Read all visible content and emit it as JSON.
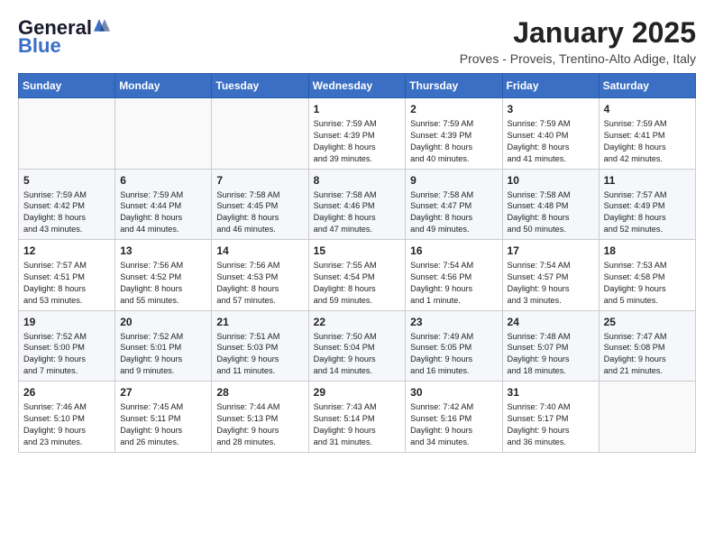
{
  "header": {
    "logo_general": "General",
    "logo_blue": "Blue",
    "month_title": "January 2025",
    "subtitle": "Proves - Proveis, Trentino-Alto Adige, Italy"
  },
  "weekdays": [
    "Sunday",
    "Monday",
    "Tuesday",
    "Wednesday",
    "Thursday",
    "Friday",
    "Saturday"
  ],
  "weeks": [
    [
      {
        "day": "",
        "content": ""
      },
      {
        "day": "",
        "content": ""
      },
      {
        "day": "",
        "content": ""
      },
      {
        "day": "1",
        "content": "Sunrise: 7:59 AM\nSunset: 4:39 PM\nDaylight: 8 hours\nand 39 minutes."
      },
      {
        "day": "2",
        "content": "Sunrise: 7:59 AM\nSunset: 4:39 PM\nDaylight: 8 hours\nand 40 minutes."
      },
      {
        "day": "3",
        "content": "Sunrise: 7:59 AM\nSunset: 4:40 PM\nDaylight: 8 hours\nand 41 minutes."
      },
      {
        "day": "4",
        "content": "Sunrise: 7:59 AM\nSunset: 4:41 PM\nDaylight: 8 hours\nand 42 minutes."
      }
    ],
    [
      {
        "day": "5",
        "content": "Sunrise: 7:59 AM\nSunset: 4:42 PM\nDaylight: 8 hours\nand 43 minutes."
      },
      {
        "day": "6",
        "content": "Sunrise: 7:59 AM\nSunset: 4:44 PM\nDaylight: 8 hours\nand 44 minutes."
      },
      {
        "day": "7",
        "content": "Sunrise: 7:58 AM\nSunset: 4:45 PM\nDaylight: 8 hours\nand 46 minutes."
      },
      {
        "day": "8",
        "content": "Sunrise: 7:58 AM\nSunset: 4:46 PM\nDaylight: 8 hours\nand 47 minutes."
      },
      {
        "day": "9",
        "content": "Sunrise: 7:58 AM\nSunset: 4:47 PM\nDaylight: 8 hours\nand 49 minutes."
      },
      {
        "day": "10",
        "content": "Sunrise: 7:58 AM\nSunset: 4:48 PM\nDaylight: 8 hours\nand 50 minutes."
      },
      {
        "day": "11",
        "content": "Sunrise: 7:57 AM\nSunset: 4:49 PM\nDaylight: 8 hours\nand 52 minutes."
      }
    ],
    [
      {
        "day": "12",
        "content": "Sunrise: 7:57 AM\nSunset: 4:51 PM\nDaylight: 8 hours\nand 53 minutes."
      },
      {
        "day": "13",
        "content": "Sunrise: 7:56 AM\nSunset: 4:52 PM\nDaylight: 8 hours\nand 55 minutes."
      },
      {
        "day": "14",
        "content": "Sunrise: 7:56 AM\nSunset: 4:53 PM\nDaylight: 8 hours\nand 57 minutes."
      },
      {
        "day": "15",
        "content": "Sunrise: 7:55 AM\nSunset: 4:54 PM\nDaylight: 8 hours\nand 59 minutes."
      },
      {
        "day": "16",
        "content": "Sunrise: 7:54 AM\nSunset: 4:56 PM\nDaylight: 9 hours\nand 1 minute."
      },
      {
        "day": "17",
        "content": "Sunrise: 7:54 AM\nSunset: 4:57 PM\nDaylight: 9 hours\nand 3 minutes."
      },
      {
        "day": "18",
        "content": "Sunrise: 7:53 AM\nSunset: 4:58 PM\nDaylight: 9 hours\nand 5 minutes."
      }
    ],
    [
      {
        "day": "19",
        "content": "Sunrise: 7:52 AM\nSunset: 5:00 PM\nDaylight: 9 hours\nand 7 minutes."
      },
      {
        "day": "20",
        "content": "Sunrise: 7:52 AM\nSunset: 5:01 PM\nDaylight: 9 hours\nand 9 minutes."
      },
      {
        "day": "21",
        "content": "Sunrise: 7:51 AM\nSunset: 5:03 PM\nDaylight: 9 hours\nand 11 minutes."
      },
      {
        "day": "22",
        "content": "Sunrise: 7:50 AM\nSunset: 5:04 PM\nDaylight: 9 hours\nand 14 minutes."
      },
      {
        "day": "23",
        "content": "Sunrise: 7:49 AM\nSunset: 5:05 PM\nDaylight: 9 hours\nand 16 minutes."
      },
      {
        "day": "24",
        "content": "Sunrise: 7:48 AM\nSunset: 5:07 PM\nDaylight: 9 hours\nand 18 minutes."
      },
      {
        "day": "25",
        "content": "Sunrise: 7:47 AM\nSunset: 5:08 PM\nDaylight: 9 hours\nand 21 minutes."
      }
    ],
    [
      {
        "day": "26",
        "content": "Sunrise: 7:46 AM\nSunset: 5:10 PM\nDaylight: 9 hours\nand 23 minutes."
      },
      {
        "day": "27",
        "content": "Sunrise: 7:45 AM\nSunset: 5:11 PM\nDaylight: 9 hours\nand 26 minutes."
      },
      {
        "day": "28",
        "content": "Sunrise: 7:44 AM\nSunset: 5:13 PM\nDaylight: 9 hours\nand 28 minutes."
      },
      {
        "day": "29",
        "content": "Sunrise: 7:43 AM\nSunset: 5:14 PM\nDaylight: 9 hours\nand 31 minutes."
      },
      {
        "day": "30",
        "content": "Sunrise: 7:42 AM\nSunset: 5:16 PM\nDaylight: 9 hours\nand 34 minutes."
      },
      {
        "day": "31",
        "content": "Sunrise: 7:40 AM\nSunset: 5:17 PM\nDaylight: 9 hours\nand 36 minutes."
      },
      {
        "day": "",
        "content": ""
      }
    ]
  ]
}
